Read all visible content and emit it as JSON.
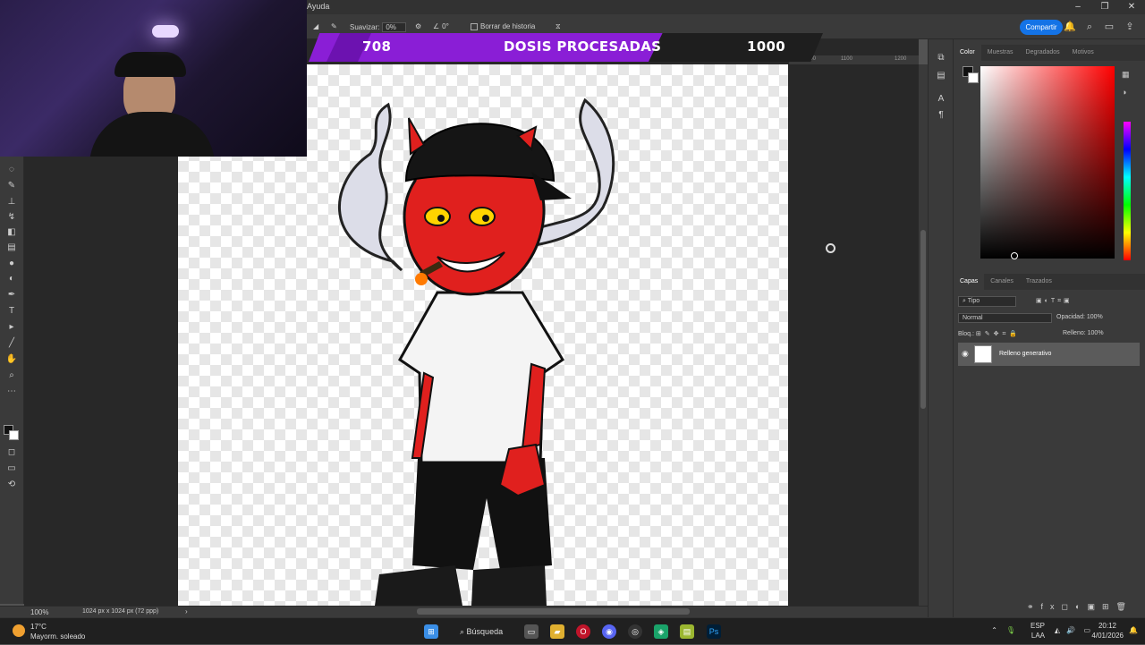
{
  "menubar": {
    "help_label": "Ayuda",
    "window_controls": [
      "–",
      "❐",
      "✕"
    ]
  },
  "options": {
    "smoothing_label": "Suavizar:",
    "smoothing_value": "0%",
    "angle_value": "0°",
    "erase_history_label": "Borrar de historia"
  },
  "header": {
    "share_label": "Compartir"
  },
  "overlay": {
    "processed": "708",
    "title": "DOSIS PROCESADAS",
    "goal": "1000"
  },
  "ruler": {
    "ticks": [
      "100",
      "1100",
      "1200"
    ]
  },
  "status": {
    "zoom": "100%",
    "doc_info": "1024 px x 1024 px (72 ppp)"
  },
  "color_panel": {
    "tabs": [
      "Color",
      "Muestras",
      "Degradados",
      "Motivos"
    ],
    "active_tab": "Color",
    "foreground": "#111111",
    "background": "#ffffff"
  },
  "layers_panel": {
    "tabs": [
      "Capas",
      "Canales",
      "Trazados"
    ],
    "active_tab": "Capas",
    "filter_label": "Tipo",
    "blend_mode": "Normal",
    "opacity_label": "Opacidad:",
    "opacity_value": "100%",
    "lock_label": "Bloq.:",
    "fill_label": "Relleno:",
    "fill_value": "100%",
    "layers": [
      {
        "name": "Relleno generativo",
        "visible": true
      }
    ]
  },
  "taskbar": {
    "weather_temp": "17°C",
    "weather_desc": "Mayorm. soleado",
    "search_label": "Búsqueda",
    "language": "ESP",
    "language_sub": "LAA",
    "time": "20:12",
    "date": "4/01/2026"
  },
  "colors": {
    "accent": "#1473e6",
    "overlay_purple": "#8a1ed6",
    "character_red": "#e0201e"
  }
}
